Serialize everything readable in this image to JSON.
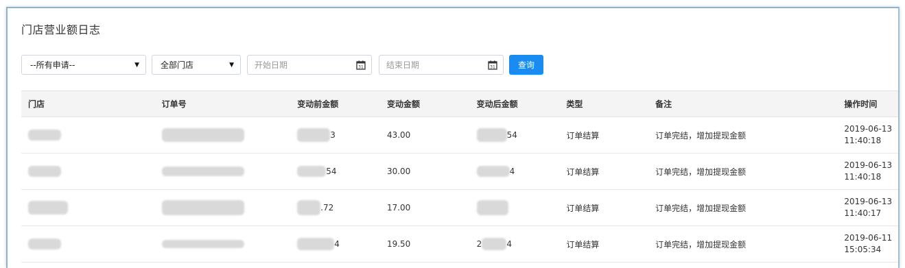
{
  "page": {
    "title": "门店营业额日志"
  },
  "filters": {
    "status_select": "--所有申请--",
    "store_select": "全部门店",
    "start_date_placeholder": "开始日期",
    "end_date_placeholder": "结束日期",
    "query_button": "查询"
  },
  "table": {
    "headers": [
      "门店",
      "订单号",
      "变动前金额",
      "变动金额",
      "变动后金额",
      "类型",
      "备注",
      "操作时间"
    ],
    "rows": [
      {
        "store": "",
        "order_no": "",
        "before_amount_tail": "3",
        "change_amount": "43.00",
        "after_amount_tail": "54",
        "type": "订单结算",
        "remark": "订单完结，增加提现金额",
        "date": "2019-06-13",
        "time": "11:40:18"
      },
      {
        "store": "",
        "order_no": "",
        "before_amount_tail": "54",
        "change_amount": "30.00",
        "after_amount_tail": "4",
        "type": "订单结算",
        "remark": "订单完结，增加提现金额",
        "date": "2019-06-13",
        "time": "11:40:18"
      },
      {
        "store": "",
        "order_no": "",
        "before_amount_tail": ".72",
        "change_amount": "17.00",
        "after_amount_tail": "",
        "type": "订单结算",
        "remark": "订单完结，增加提现金额",
        "date": "2019-06-13",
        "time": "11:40:17"
      },
      {
        "store": "",
        "order_no": "",
        "before_amount_tail": "4",
        "change_amount": "19.50",
        "after_amount_head": "2",
        "after_amount_tail": "4",
        "type": "订单结算",
        "remark": "订单完结，增加提现金额",
        "date": "2019-06-11",
        "time": "15:05:34"
      }
    ]
  },
  "colors": {
    "accent": "#1a8cf0",
    "header_bg": "#f4f4f4",
    "frame_border": "#8fb3c9"
  },
  "icons": {
    "date_picker": "calendar-icon",
    "select_caret": "caret-down-icon"
  }
}
